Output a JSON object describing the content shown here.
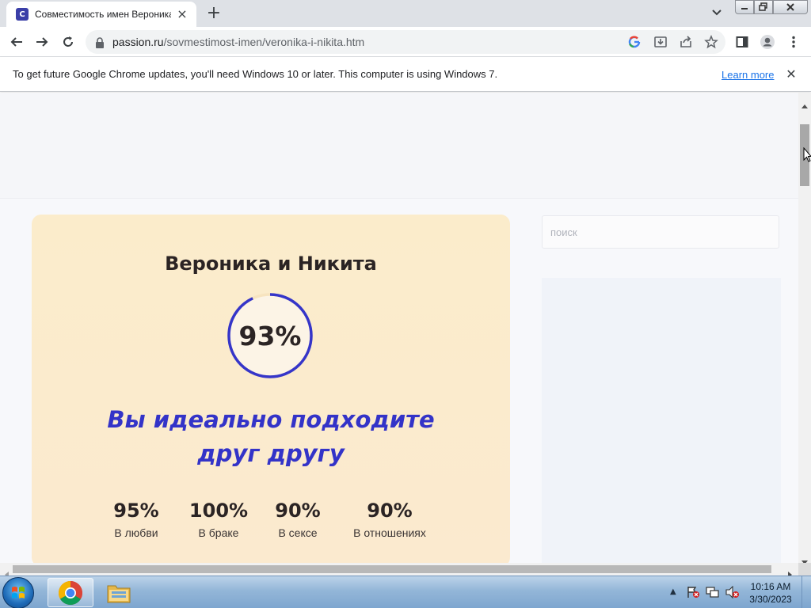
{
  "browser": {
    "tab_title": "Совместимость имен Вероника",
    "favicon_letter": "С",
    "url_host": "passion.ru",
    "url_path": "/sovmestimost-imen/veronika-i-nikita.htm"
  },
  "infobar": {
    "message": "To get future Google Chrome updates, you'll need Windows 10 or later. This computer is using Windows 7.",
    "link": "Learn more"
  },
  "page": {
    "title": "Вероника и Никита",
    "overall_percent": 93,
    "overall_label": "93%",
    "verdict": "Вы идеально подходите друг другу",
    "stats": [
      {
        "value": "95%",
        "label": "В любви"
      },
      {
        "value": "100%",
        "label": "В браке"
      },
      {
        "value": "90%",
        "label": "В сексе"
      },
      {
        "value": "90%",
        "label": "В отношениях"
      }
    ],
    "search_placeholder": "поиск"
  },
  "taskbar": {
    "time": "10:16 AM",
    "date": "3/30/2023"
  },
  "colors": {
    "accent": "#3333c8",
    "card_bg": "#fbeccb",
    "ring": "#3535c9"
  }
}
